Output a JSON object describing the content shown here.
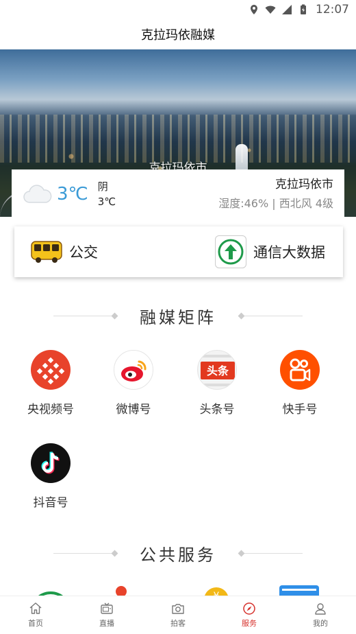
{
  "status_bar": {
    "time": "12:07"
  },
  "header": {
    "title": "克拉玛依融媒"
  },
  "banner": {
    "caption": "克拉玛依市"
  },
  "weather": {
    "temperature": "3℃",
    "condition": "阴",
    "low_temp": "3℃",
    "city": "克拉玛依市",
    "detail": "湿度:46% | 西北风 4级"
  },
  "quick_services": [
    {
      "label": "公交",
      "icon": "bus-icon"
    },
    {
      "label": "通信大数据",
      "icon": "data-arrow-icon"
    }
  ],
  "media_matrix": {
    "title": "融媒矩阵",
    "items": [
      {
        "label": "央视频号",
        "icon": "cctv-video-icon",
        "color": "#e8432b"
      },
      {
        "label": "微博号",
        "icon": "weibo-icon",
        "color": "#e6162d"
      },
      {
        "label": "头条号",
        "icon": "toutiao-icon",
        "color": "#e2391f"
      },
      {
        "label": "快手号",
        "icon": "kuaishou-icon",
        "color": "#ff5000"
      },
      {
        "label": "抖音号",
        "icon": "douyin-icon",
        "color": "#111111"
      }
    ]
  },
  "public_services": {
    "title": "公共服务"
  },
  "bottom_nav": [
    {
      "label": "首页",
      "icon": "home-icon",
      "active": false
    },
    {
      "label": "直播",
      "icon": "tv-icon",
      "active": false
    },
    {
      "label": "拍客",
      "icon": "camera-icon",
      "active": false
    },
    {
      "label": "服务",
      "icon": "compass-icon",
      "active": true
    },
    {
      "label": "我的",
      "icon": "user-icon",
      "active": false
    }
  ],
  "colors": {
    "accent": "#d6302b",
    "temp": "#3a9ad6"
  }
}
